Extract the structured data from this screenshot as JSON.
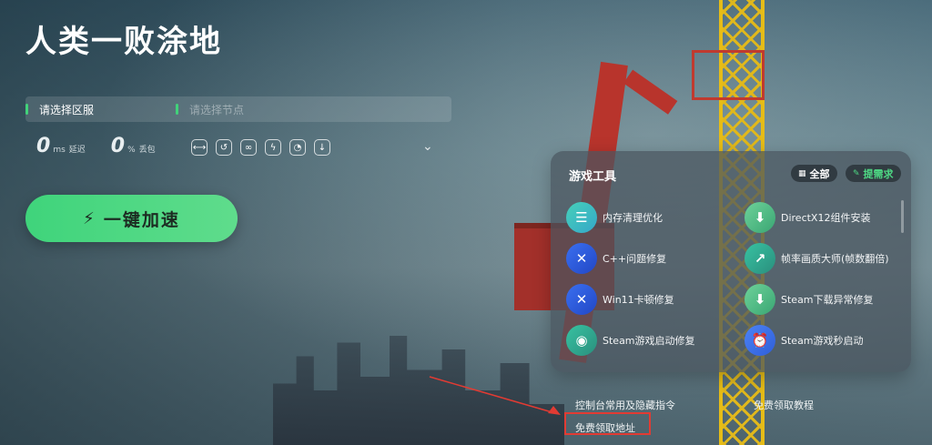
{
  "header": {
    "title": "人类一败涂地"
  },
  "selectors": {
    "region_label": "请选择区服",
    "node_placeholder": "请选择节点"
  },
  "stats": {
    "latency": {
      "value": "0",
      "unit": "ms",
      "label": "延迟"
    },
    "loss": {
      "value": "0",
      "unit": "%",
      "label": "丢包"
    }
  },
  "quick_tools": [
    {
      "icon": "link-icon"
    },
    {
      "icon": "route-icon"
    },
    {
      "icon": "network-icon"
    },
    {
      "icon": "boost-icon"
    },
    {
      "icon": "speedometer-icon"
    },
    {
      "icon": "download-icon"
    }
  ],
  "accelerate": {
    "label": "一键加速"
  },
  "tools_panel": {
    "title": "游戏工具",
    "tag_all": "全部",
    "tag_request": "提需求",
    "items": [
      {
        "name": "内存清理优化",
        "icon": "memory-clean-icon",
        "color": "#46d0b9"
      },
      {
        "name": "DirectX12组件安装",
        "icon": "component-install-icon",
        "color": "#6ed29a"
      },
      {
        "name": "C++问题修复",
        "icon": "wrench-icon",
        "color": "#3a6ff0"
      },
      {
        "name": "帧率画质大师(帧数翻倍)",
        "icon": "fps-boost-icon",
        "color": "#38c2a2"
      },
      {
        "name": "Win11卡顿修复",
        "icon": "wrench-icon",
        "color": "#3a6ff0"
      },
      {
        "name": "Steam下载异常修复",
        "icon": "component-install-icon",
        "color": "#6ed29a"
      },
      {
        "name": "Steam游戏启动修复",
        "icon": "steam-icon",
        "color": "#38c2a2"
      },
      {
        "name": "Steam游戏秒启动",
        "icon": "alarm-clock-icon",
        "color": "#4c83f5"
      }
    ]
  },
  "links": {
    "console": "控制台常用及隐藏指令",
    "tutorial": "免费领取教程",
    "free": "免费领取地址"
  },
  "colors": {
    "accent": "#41d27a",
    "annotation": "#e23b33"
  }
}
